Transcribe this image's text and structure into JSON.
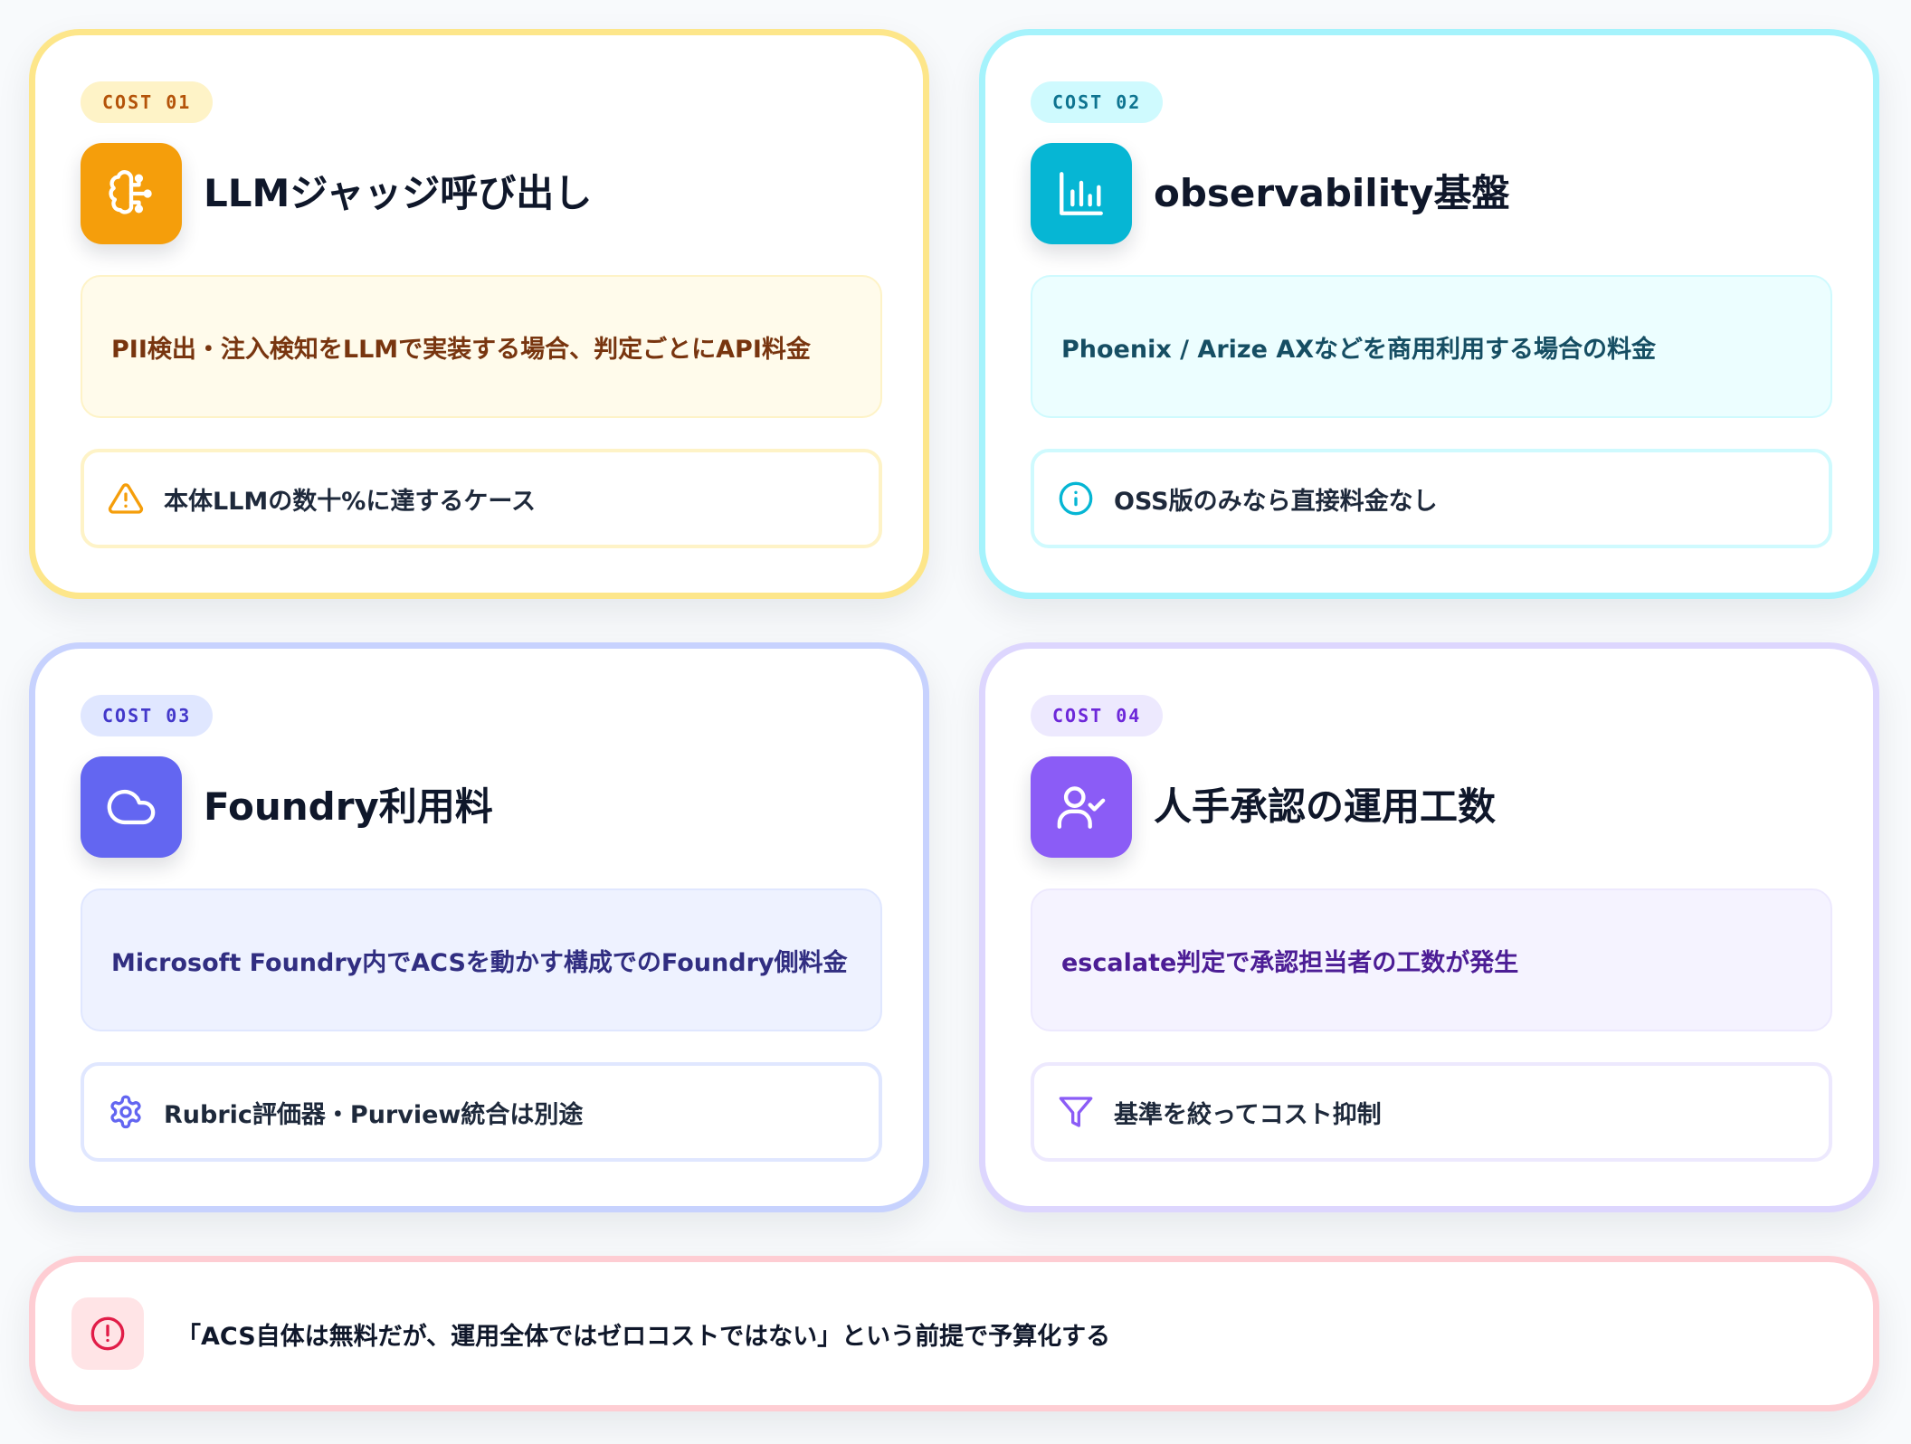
{
  "cards": [
    {
      "badge": "COST 01",
      "icon": "brain-icon",
      "title": "LLMジャッジ呼び出し",
      "description": "PII検出・注入検知をLLMで実装する場合、判定ごとにAPI料金",
      "note_icon": "warning-icon",
      "note": "本体LLMの数十%に達するケース",
      "accent": "#f59e0b"
    },
    {
      "badge": "COST 02",
      "icon": "bar-chart-icon",
      "title": "observability基盤",
      "description": "Phoenix / Arize AXなどを商用利用する場合の料金",
      "note_icon": "info-icon",
      "note": "OSS版のみなら直接料金なし",
      "accent": "#06b6d4"
    },
    {
      "badge": "COST 03",
      "icon": "cloud-icon",
      "title": "Foundry利用料",
      "description": "Microsoft Foundry内でACSを動かす構成でのFoundry側料金",
      "note_icon": "gear-icon",
      "note": "Rubric評価器・Purview統合は別途",
      "accent": "#6366f1"
    },
    {
      "badge": "COST 04",
      "icon": "user-check-icon",
      "title": "人手承認の運用工数",
      "description": "escalate判定で承認担当者の工数が発生",
      "note_icon": "filter-icon",
      "note": "基準を絞ってコスト抑制",
      "accent": "#8b5cf6"
    }
  ],
  "footer": {
    "icon": "alert-circle-icon",
    "text": "「ACS自体は無料だが、運用全体ではゼロコストではない」という前提で予算化する",
    "accent": "#e11d48"
  }
}
